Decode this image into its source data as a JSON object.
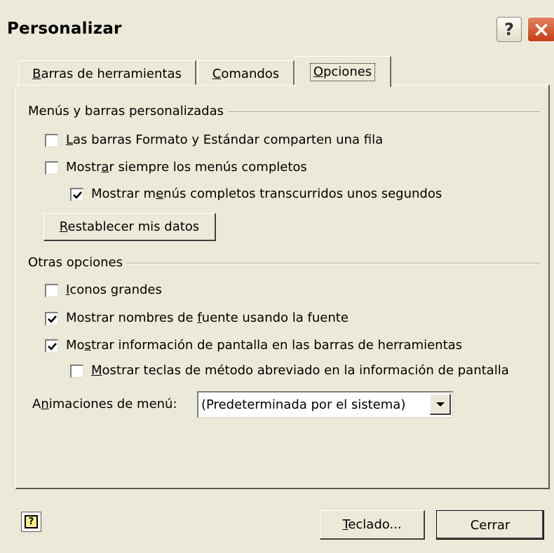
{
  "window": {
    "title": "Personalizar"
  },
  "titlebar": {
    "help_glyph": "?",
    "close_glyph": "×"
  },
  "tabs": [
    {
      "label_u": "B",
      "label_rest": "arras de herramientas",
      "selected": false
    },
    {
      "label_u": "C",
      "label_rest": "omandos",
      "selected": false
    },
    {
      "label_u": "O",
      "label_rest": "pciones",
      "selected": true
    }
  ],
  "menus_group": {
    "label": "Menús y barras personalizadas",
    "options": [
      {
        "pre": "",
        "u": "L",
        "post": "as barras Formato y Estándar comparten una fila",
        "checked": false
      },
      {
        "pre": "Mostr",
        "u": "a",
        "post": "r siempre los menús completos",
        "checked": false
      },
      {
        "pre": "Mostrar m",
        "u": "e",
        "post": "nús completos transcurridos unos segundos",
        "checked": true
      }
    ],
    "reset_button": {
      "u": "R",
      "rest": "establecer mis datos"
    }
  },
  "other_group": {
    "label": "Otras opciones",
    "options": [
      {
        "pre": "",
        "u": "I",
        "post": "conos grandes",
        "checked": false
      },
      {
        "pre": "Mostrar nombres de ",
        "u": "f",
        "post": "uente usando la fuente",
        "checked": true
      },
      {
        "pre": "Mo",
        "u": "s",
        "post": "trar información de pantalla en las barras de herramientas",
        "checked": true
      },
      {
        "pre": "",
        "u": "M",
        "post": "ostrar teclas de método abreviado en la información de pantalla",
        "checked": false
      }
    ]
  },
  "animations": {
    "label_pre": "A",
    "label_u": "n",
    "label_post": "imaciones de menú:",
    "selected": "(Predeterminada por el sistema)"
  },
  "footer": {
    "keyboard_button": {
      "u": "T",
      "rest": "eclado..."
    },
    "close_button": "Cerrar"
  },
  "colors": {
    "face": "#ece9d8",
    "close_red": "#c63e16"
  }
}
